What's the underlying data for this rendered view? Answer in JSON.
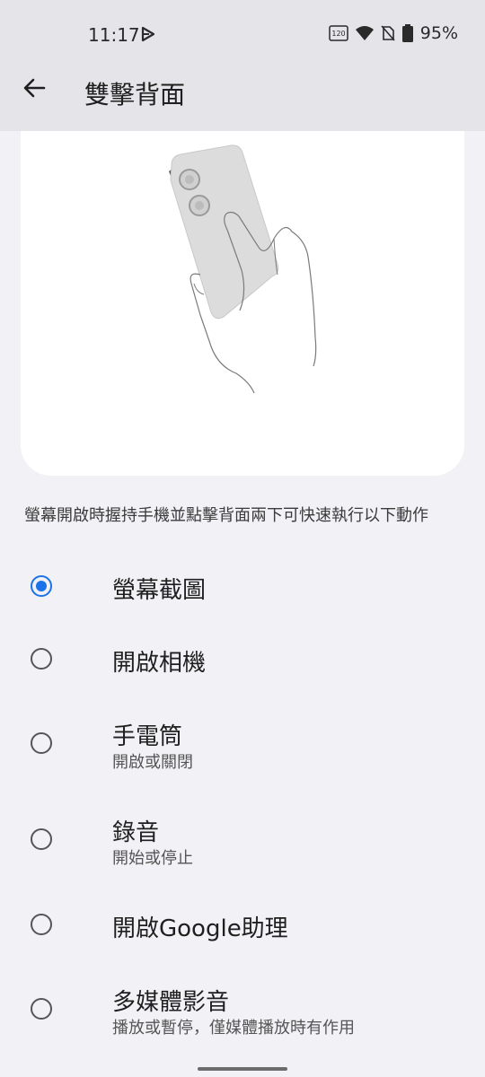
{
  "status_bar": {
    "time": "11:17",
    "battery": "95%",
    "icons": [
      "play-store-icon",
      "refresh-120hz-icon",
      "wifi-icon",
      "no-sim-icon",
      "battery-icon"
    ]
  },
  "app_bar": {
    "title": "雙擊背面",
    "back_icon": "back-arrow-icon"
  },
  "illustration": {
    "name": "hand-holding-phone-illustration"
  },
  "description": "螢幕開啟時握持手機並點擊背面兩下可快速執行以下動作",
  "options": [
    {
      "title": "螢幕截圖",
      "subtitle": "",
      "selected": true
    },
    {
      "title": "開啟相機",
      "subtitle": "",
      "selected": false
    },
    {
      "title": "手電筒",
      "subtitle": "開啟或關閉",
      "selected": false
    },
    {
      "title": "錄音",
      "subtitle": "開始或停止",
      "selected": false
    },
    {
      "title": "開啟Google助理",
      "subtitle": "",
      "selected": false
    },
    {
      "title": "多媒體影音",
      "subtitle": "播放或暫停，僅媒體播放時有作用",
      "selected": false
    }
  ],
  "colors": {
    "accent": "#1a73e8",
    "background": "#f2f1f5",
    "header": "#e5e4e8"
  }
}
